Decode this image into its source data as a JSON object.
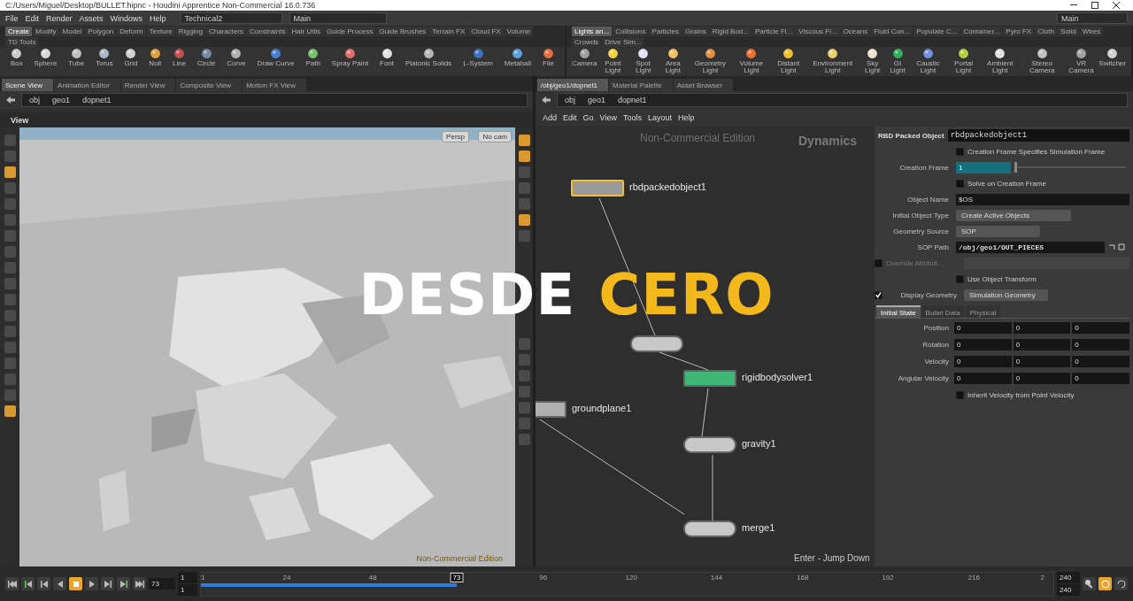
{
  "window": {
    "title": "C:/Users/Miguel/Desktop/BULLET.hipnc - Houdini Apprentice Non-Commercial 16.0.736"
  },
  "menu": [
    "File",
    "Edit",
    "Render",
    "Assets",
    "Windows",
    "Help"
  ],
  "desktop": "Technical2",
  "main_left": "Main",
  "main_right": "Main",
  "shelf_left": {
    "tabs": [
      {
        "label": "Create",
        "selected": true
      },
      {
        "label": "Modify",
        "selected": false
      },
      {
        "label": "Model",
        "selected": false
      },
      {
        "label": "Polygon",
        "selected": false
      },
      {
        "label": "Deform",
        "selected": false
      },
      {
        "label": "Texture",
        "selected": false
      },
      {
        "label": "Rigging",
        "selected": false
      },
      {
        "label": "Characters",
        "selected": false
      },
      {
        "label": "Constraints",
        "selected": false
      },
      {
        "label": "Hair Utils",
        "selected": false
      },
      {
        "label": "Guide Process",
        "selected": false
      },
      {
        "label": "Guide Brushes",
        "selected": false
      },
      {
        "label": "Terrain FX",
        "selected": false
      },
      {
        "label": "Cloud FX",
        "selected": false
      },
      {
        "label": "Volume",
        "selected": false
      },
      {
        "label": "TD Tools",
        "selected": false
      }
    ],
    "tools": [
      "Box",
      "Sphere",
      "Tube",
      "Torus",
      "Grid",
      "Null",
      "Line",
      "Circle",
      "Curve",
      "Draw Curve",
      "Path",
      "Spray Paint",
      "Font",
      "Platonic Solids",
      "L-System",
      "Metaball",
      "File"
    ]
  },
  "shelf_right": {
    "tabs": [
      {
        "label": "Lights an...",
        "selected": true
      },
      {
        "label": "Collisions",
        "selected": false
      },
      {
        "label": "Particles",
        "selected": false
      },
      {
        "label": "Grains",
        "selected": false
      },
      {
        "label": "Rigid Bod...",
        "selected": false
      },
      {
        "label": "Particle Fl...",
        "selected": false
      },
      {
        "label": "Viscous Fl...",
        "selected": false
      },
      {
        "label": "Oceans",
        "selected": false
      },
      {
        "label": "Fluid Con...",
        "selected": false
      },
      {
        "label": "Populate C...",
        "selected": false
      },
      {
        "label": "Container...",
        "selected": false
      },
      {
        "label": "Pyro FX",
        "selected": false
      },
      {
        "label": "Cloth",
        "selected": false
      },
      {
        "label": "Solid",
        "selected": false
      },
      {
        "label": "Wires",
        "selected": false
      },
      {
        "label": "Crowds",
        "selected": false
      },
      {
        "label": "Drive Sim...",
        "selected": false
      }
    ],
    "tools": [
      "Camera",
      "Point Light",
      "Spot Light",
      "Area Light",
      "Geometry Light",
      "Volume Light",
      "Distant Light",
      "Environment Light",
      "Sky Light",
      "GI Light",
      "Caustic Light",
      "Portal Light",
      "Ambient Light",
      "Stereo Camera",
      "VR Camera",
      "Switcher"
    ]
  },
  "scene_pane": {
    "tabs": [
      {
        "label": "Scene View",
        "selected": true
      },
      {
        "label": "Animation Editor",
        "selected": false
      },
      {
        "label": "Render View",
        "selected": false
      },
      {
        "label": "Composite View",
        "selected": false
      },
      {
        "label": "Motion FX View",
        "selected": false
      }
    ],
    "path": [
      "obj",
      "geo1",
      "dopnet1"
    ],
    "header": "View",
    "camera_menus": [
      "Persp",
      "No cam"
    ],
    "watermark": "Non-Commercial Edition",
    "viewport": {
      "kind": "picture"
    }
  },
  "network_pane": {
    "tabs": [
      {
        "label": "/obj/geo1/dopnet1",
        "selected": true
      },
      {
        "label": "Material Palette",
        "selected": false
      },
      {
        "label": "Asset Browser",
        "selected": false
      }
    ],
    "path": [
      "obj",
      "geo1",
      "dopnet1"
    ],
    "menu": [
      "Add",
      "Edit",
      "Go",
      "View",
      "Tools",
      "Layout",
      "Help"
    ],
    "edition": "Non-Commercial Edition",
    "context": "Dynamics",
    "hint": "Enter - Jump Down",
    "nodes": [
      {
        "label": "rbdpackedobject1",
        "selected": true,
        "color": "#9a9a9a"
      },
      {
        "selected": false,
        "color": "#c8c8c8"
      },
      {
        "label": "rigidbodysolver1",
        "selected": false,
        "color": "#3fb877"
      },
      {
        "label": "groundplane1",
        "selected": false,
        "color": "#b0b0b0"
      },
      {
        "label": "gravity1",
        "selected": false,
        "color": "#c8c8c8"
      },
      {
        "label": "merge1",
        "selected": false,
        "color": "#c8c8c8"
      }
    ]
  },
  "parameters": {
    "type": "RBD Packed Object",
    "name": "rbdpackedobject1",
    "rows": [
      {
        "kind": "checkbox",
        "label": "Creation Frame Specifies Simulation Frame",
        "checked": false
      },
      {
        "kind": "slider",
        "label": "Creation Frame",
        "value": "1",
        "level": 0.0
      },
      {
        "kind": "checkbox",
        "label": "Solve on Creation Frame",
        "checked": false
      },
      {
        "kind": "field",
        "label": "Object Name",
        "value": "$OS"
      },
      {
        "kind": "menu",
        "label": "Initial Object Type",
        "value": "Create Active Objects"
      },
      {
        "kind": "menu",
        "label": "Geometry Source",
        "value": "SOP"
      },
      {
        "kind": "path",
        "label": "SOP Path",
        "value": "/obj/geo1/OUT_PIECES"
      },
      {
        "kind": "toggled_field",
        "label": "Override Attribut...",
        "checked": false,
        "disabled": true
      },
      {
        "kind": "checkbox",
        "label": "Use Object Transform",
        "checked": false
      },
      {
        "kind": "toggled_menu",
        "label": "Display Geometry",
        "checked": true,
        "value": "Simulation Geometry"
      }
    ],
    "tabs": [
      {
        "label": "Initial State",
        "selected": true
      },
      {
        "label": "Bullet Data",
        "selected": false
      },
      {
        "label": "Physical",
        "selected": false
      }
    ],
    "vectors": [
      {
        "label": "Position",
        "values": [
          "0",
          "0",
          "0"
        ]
      },
      {
        "label": "Rotation",
        "values": [
          "0",
          "0",
          "0"
        ]
      },
      {
        "label": "Velocity",
        "values": [
          "0",
          "0",
          "0"
        ]
      },
      {
        "label": "Angular Velocity",
        "values": [
          "0",
          "0",
          "0"
        ]
      }
    ],
    "inherit": {
      "label": "Inherit Velocity from Point Velocity",
      "checked": false
    }
  },
  "timeline": {
    "transport": [
      {
        "kind": "first",
        "selected": false
      },
      {
        "kind": "prev_key",
        "selected": false
      },
      {
        "kind": "prev_frame",
        "selected": false
      },
      {
        "kind": "reverse",
        "selected": false
      },
      {
        "kind": "stop",
        "selected": true
      },
      {
        "kind": "play",
        "selected": false
      },
      {
        "kind": "next_frame",
        "selected": false
      },
      {
        "kind": "next_key",
        "selected": false
      },
      {
        "kind": "last",
        "selected": false
      }
    ],
    "frame": "73",
    "start": [
      "1",
      "1"
    ],
    "ruler": [
      "1",
      "24",
      "48",
      "96",
      "120",
      "144",
      "168",
      "192",
      "216",
      "2"
    ],
    "playhead": "73",
    "level": 0.3,
    "end": [
      "240",
      "240"
    ]
  },
  "overlay": [
    {
      "text": "DESDE",
      "color": "#ffffff"
    },
    {
      "text": "CERO",
      "color": "#f2b81c"
    }
  ]
}
